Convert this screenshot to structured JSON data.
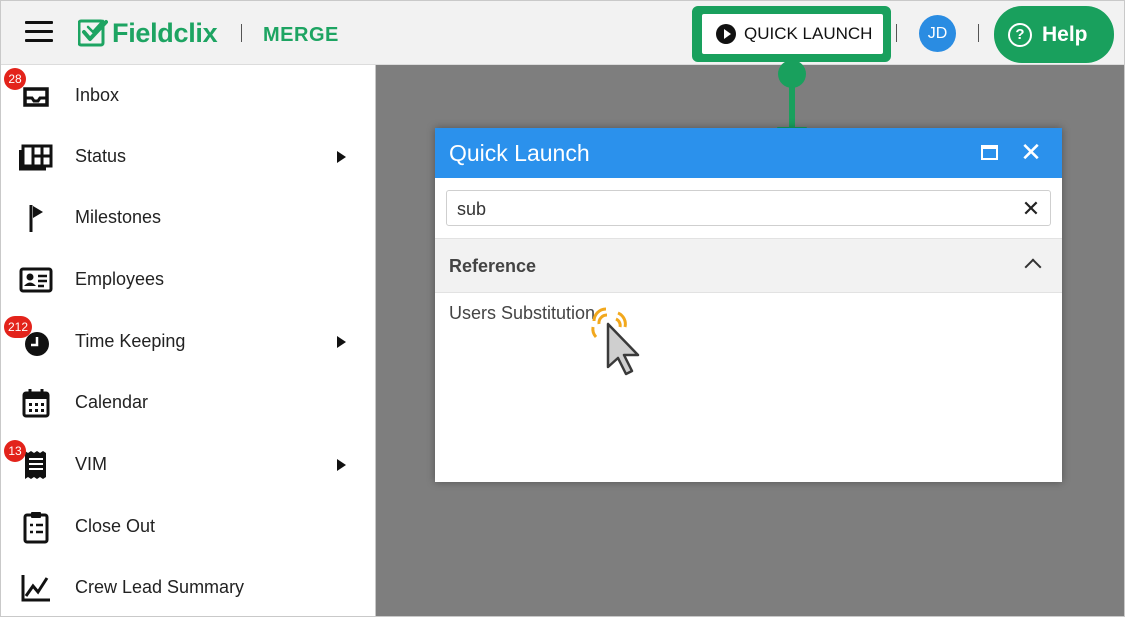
{
  "header": {
    "brand": "Fieldclix",
    "app_name": "MERGE",
    "quick_launch_label": "QUICK LAUNCH",
    "user_initials": "JD",
    "help_label": "Help",
    "colors": {
      "brand_green": "#1da462",
      "accent_blue": "#2b91ec",
      "badge_red": "#e3231b"
    }
  },
  "sidebar": {
    "items": [
      {
        "label": "Inbox",
        "icon": "inbox-icon",
        "badge": "28",
        "has_submenu": false
      },
      {
        "label": "Status",
        "icon": "dashboard-icon",
        "badge": null,
        "has_submenu": true
      },
      {
        "label": "Milestones",
        "icon": "flag-icon",
        "badge": null,
        "has_submenu": false
      },
      {
        "label": "Employees",
        "icon": "id-card-icon",
        "badge": null,
        "has_submenu": false
      },
      {
        "label": "Time Keeping",
        "icon": "clock-icon",
        "badge": "212",
        "has_submenu": true
      },
      {
        "label": "Calendar",
        "icon": "calendar-icon",
        "badge": null,
        "has_submenu": false
      },
      {
        "label": "VIM",
        "icon": "receipt-icon",
        "badge": "13",
        "has_submenu": true
      },
      {
        "label": "Close Out",
        "icon": "clipboard-list-icon",
        "badge": null,
        "has_submenu": false
      },
      {
        "label": "Crew Lead Summary",
        "icon": "line-chart-icon",
        "badge": null,
        "has_submenu": false
      }
    ]
  },
  "dialog": {
    "title": "Quick Launch",
    "search_value": "sub",
    "section_title": "Reference",
    "results": [
      {
        "label": "Users Substitution"
      }
    ]
  }
}
